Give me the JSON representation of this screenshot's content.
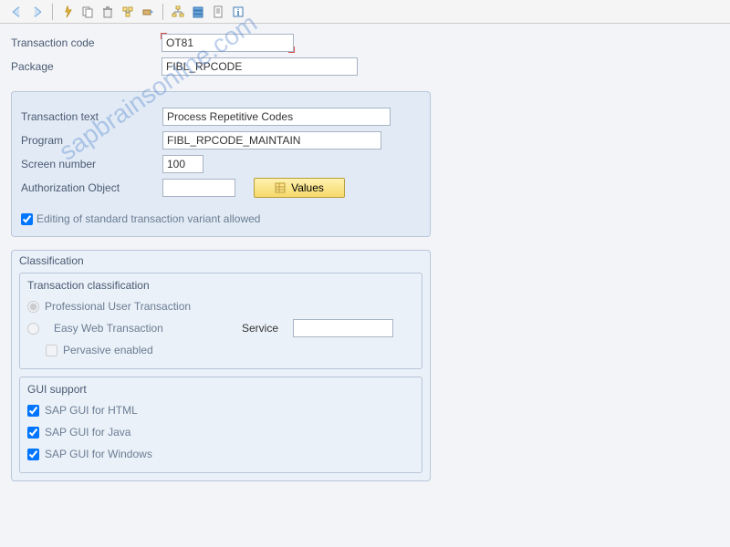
{
  "watermark": "sapbrainsonline.com",
  "toolbar": {
    "back": "back",
    "forward": "forward"
  },
  "fields": {
    "tcode_label": "Transaction code",
    "tcode_value": "OT81",
    "package_label": "Package",
    "package_value": "FIBL_RPCODE",
    "ttext_label": "Transaction text",
    "ttext_value": "Process Repetitive Codes",
    "program_label": "Program",
    "program_value": "FIBL_RPCODE_MAINTAIN",
    "scrnum_label": "Screen number",
    "scrnum_value": "100",
    "auth_label": "Authorization Object",
    "auth_value": "",
    "values_btn": "Values",
    "edit_variant_label": "Editing of standard transaction variant allowed"
  },
  "classification": {
    "title": "Classification",
    "tc_title": "Transaction classification",
    "radio_pro": "Professional User Transaction",
    "radio_easy": "Easy Web Transaction",
    "service_label": "Service",
    "service_value": "",
    "pervasive": "Pervasive enabled",
    "gui_title": "GUI support",
    "gui_html": "SAP GUI for HTML",
    "gui_java": "SAP GUI for Java",
    "gui_win": "SAP GUI for Windows"
  }
}
